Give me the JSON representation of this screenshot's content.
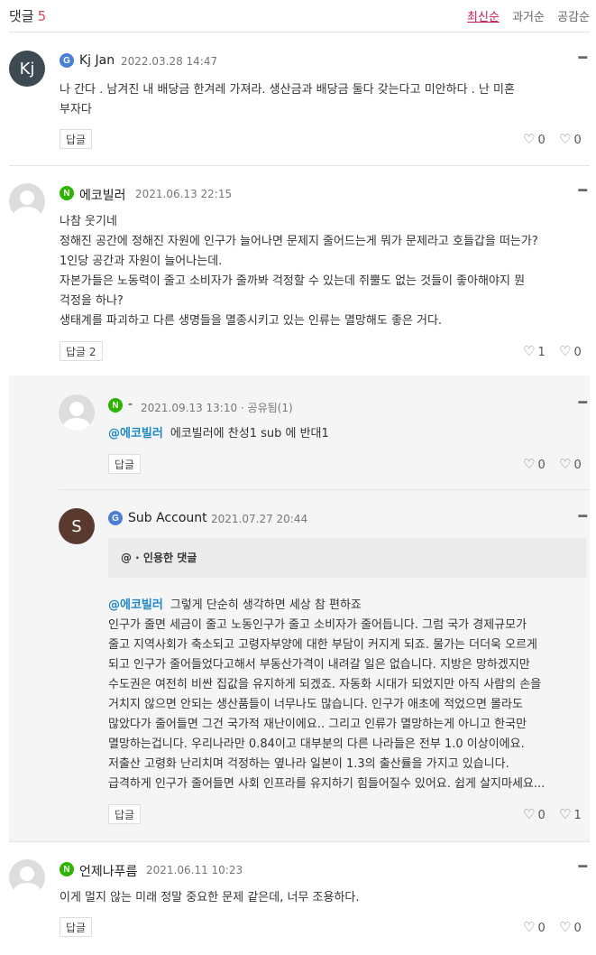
{
  "header": {
    "title": "댓글",
    "count": "5",
    "sort": [
      "최신순",
      "과거순",
      "공감순"
    ]
  },
  "comments": [
    {
      "avatar_text": "Kj",
      "badge": "G",
      "author": "Kj Jan",
      "date": "2022.03.28 14:47",
      "lines": [
        "나 간다 . 남겨진 내 배당금 한겨레 가져라. 생산금과 배당금 둘다 갖는다고 미안하다 . 난 미혼",
        "부자다"
      ],
      "reply_label": "답글",
      "likes": "0",
      "dislikes": "0"
    },
    {
      "badge": "N",
      "author": "에코빌러",
      "date": "2021.06.13 22:15",
      "lines": [
        "나참 웃기네",
        "정해진 공간에 정해진 자원에 인구가 늘어나면 문제지 줄어드는게 뭐가 문제라고 호들갑을 떠는가?",
        "1인당 공간과 자원이 늘어나는데.",
        "자본가들은 노동력이 줄고 소비자가 줄까봐 걱정할 수 있는데 쥐뿔도 없는 것들이 좋아해야지 뭔",
        "걱정을 하나?",
        "생태계를 파괴하고 다른 생명들을 멸종시키고 있는 인류는 멸망해도 좋은 거다."
      ],
      "reply_label": "답글 2",
      "likes": "1",
      "dislikes": "0"
    },
    {
      "badge": "N",
      "author": "-",
      "date": "2021.09.13 13:10 · 공유됨(1)",
      "mention": "@에코빌러",
      "text": "에코빌러에 찬성1 sub 에 반대1",
      "reply_label": "답글",
      "likes": "0",
      "dislikes": "0"
    },
    {
      "avatar_text": "S",
      "badge": "G",
      "author": "Sub Account",
      "date": "2021.07.27 20:44",
      "quote": "@ · 인용한 댓글",
      "mention": "@에코빌러",
      "first_line": "그렇게 단순히 생각하면 세상 참 편하죠",
      "lines": [
        "인구가 줄면 세금이 줄고 노동인구가 줄고 소비자가 줄어듭니다. 그럼 국가 경제규모가",
        "줄고 지역사회가 축소되고 고령자부양에 대한 부담이 커지게 되죠. 물가는 더더욱 오르게",
        "되고 인구가 줄어들었다고해서 부동산가격이 내려갈 일은 없습니다. 지방은 망하겠지만",
        "수도권은 여전히 비싼 집값을 유지하게 되겠죠. 자동화 시대가 되었지만 아직 사람의 손을",
        "거치지 않으면 안되는 생산품들이 너무나도 많습니다. 인구가 애초에 적었으면 몰라도",
        "많았다가 줄어들면 그건 국가적 재난이에요.. 그리고 인류가 멸망하는게 아니고 한국만",
        "멸망하는겁니다. 우리나라만 0.84이고 대부분의 다른 나라들은 전부 1.0 이상이에요.",
        "저출산 고령화 난리치며 걱정하는 옆나라 일본이 1.3의 출산률을 가지고 있습니다.",
        "급격하게 인구가 줄어들면 사회 인프라를 유지하기 힘들어질수 있어요. 쉽게 살지마세요..."
      ],
      "reply_label": "답글",
      "likes": "0",
      "dislikes": "1"
    },
    {
      "badge": "N",
      "author": "언제나푸름",
      "date": "2021.06.11 10:23",
      "lines": [
        "이게 멀지 않는 미래 정말 중요한 문제 같은데, 너무 조용하다."
      ],
      "reply_label": "답글",
      "likes": "0",
      "dislikes": "0"
    }
  ],
  "icons": {
    "like": "heart-icon",
    "dislike": "broken-heart-icon",
    "more": "more-icon"
  }
}
